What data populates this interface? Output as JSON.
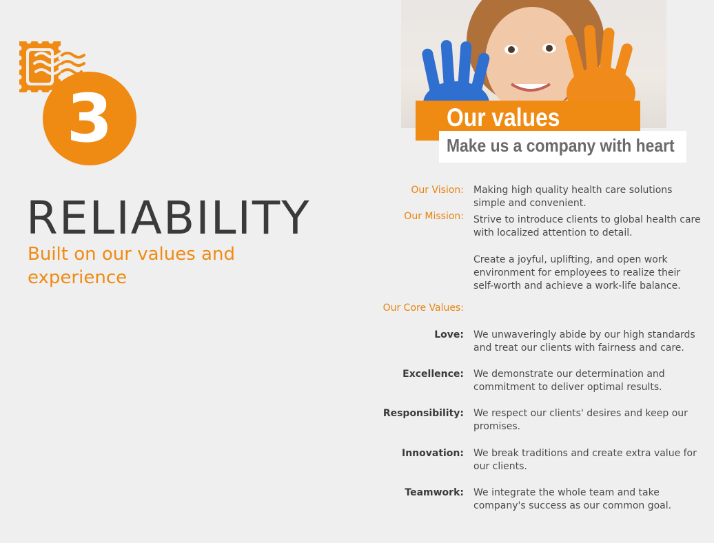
{
  "colors": {
    "accent": "#ef8a12",
    "title": "#3a3a3a",
    "background": "#efefef"
  },
  "icons": {
    "stamp": "stamp-icon"
  },
  "badge": {
    "number": "3"
  },
  "heading": {
    "title": "RELIABILITY",
    "subtitle": "Built on our values and experience"
  },
  "banner": {
    "title": "Our values",
    "tagline": "Make us a company with heart"
  },
  "photo": {
    "subject": "child-with-painted-hands-photo"
  },
  "vision": {
    "label": "Our Vision:",
    "text": "Making high quality health care solutions simple and convenient."
  },
  "mission": {
    "label": "Our Mission:",
    "text1": "Strive to introduce clients to global health care with localized attention to detail.",
    "text2": "Create a joyful, uplifting, and open work environment for employees to realize their self-worth and achieve a work-life balance."
  },
  "core_values": {
    "label": "Our Core Values:",
    "items": [
      {
        "label": "Love:",
        "text": "We unwaveringly abide by our high standards and treat our clients with fairness and care."
      },
      {
        "label": "Excellence:",
        "text": "We demonstrate our determination and commitment to deliver optimal results."
      },
      {
        "label": "Responsibility:",
        "text": "We respect our clients' desires and keep our promises."
      },
      {
        "label": "Innovation:",
        "text": "We break traditions and create extra value for our clients."
      },
      {
        "label": "Teamwork:",
        "text": "We integrate the whole team and take company's success as our common goal."
      }
    ]
  }
}
